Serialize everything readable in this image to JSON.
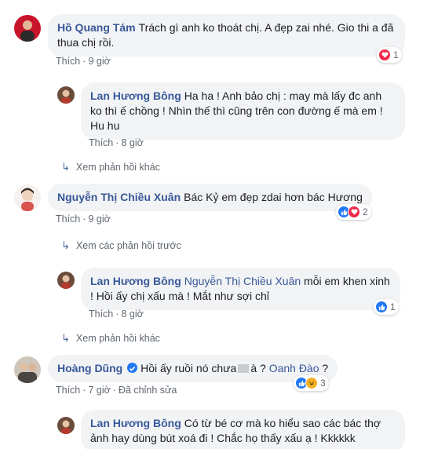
{
  "c1": {
    "author": "Hồ Quang Tám",
    "text": "Trách gì anh ko thoát chị. A đẹp zai nhé. Gio thi a đã thua chị rồi.",
    "like": "Thích",
    "time": "9 giờ",
    "reaction_count": "1"
  },
  "r1": {
    "author": "Lan Hương Bông",
    "text": "Ha ha ! Anh bảo chị : may mà lấy đc anh ko thì ế chồng ! Nhìn thế thì cũng trên con đường ế mà em ! Hu hu",
    "like": "Thích",
    "time": "8 giờ"
  },
  "more1": "Xem phản hồi khác",
  "c2": {
    "author": "Nguyễn Thị Chiều Xuân",
    "text": "Bác Kỷ em đẹp zdai hơn bác Hương",
    "like": "Thích",
    "time": "9 giờ",
    "reaction_count": "2"
  },
  "prev2": "Xem các phản hồi trước",
  "r2": {
    "author": "Lan Hương Bông",
    "mention": "Nguyễn Thị Chiều Xuân",
    "text": "mỗi em khen xinh ! Hồi ấy chị xấu mà ! Mắt như sợi chỉ",
    "like": "Thích",
    "time": "8 giờ",
    "reaction_count": "1"
  },
  "more2": "Xem phản hồi khác",
  "c3": {
    "author": "Hoàng Dũng",
    "text_before": "Hồi ấy ruồi nó chưa",
    "text_after": "à ?",
    "mention": "Oanh Đào",
    "text_end": "?",
    "like": "Thích",
    "time": "7 giờ",
    "edited": "Đã chỉnh sửa",
    "reaction_count": "3"
  },
  "r3": {
    "author": "Lan Hương Bông",
    "text": "Có từ bé cơ mà ko hiểu sao các bác thợ ảnh hay dùng bút xoá đi ! Chắc họ thấy xấu ạ ! Kkkkkk"
  },
  "colors": {
    "link": "#385898",
    "bubble": "#f2f3f5",
    "meta": "#606770",
    "like": "#2078f4",
    "love": "#f0284a"
  }
}
